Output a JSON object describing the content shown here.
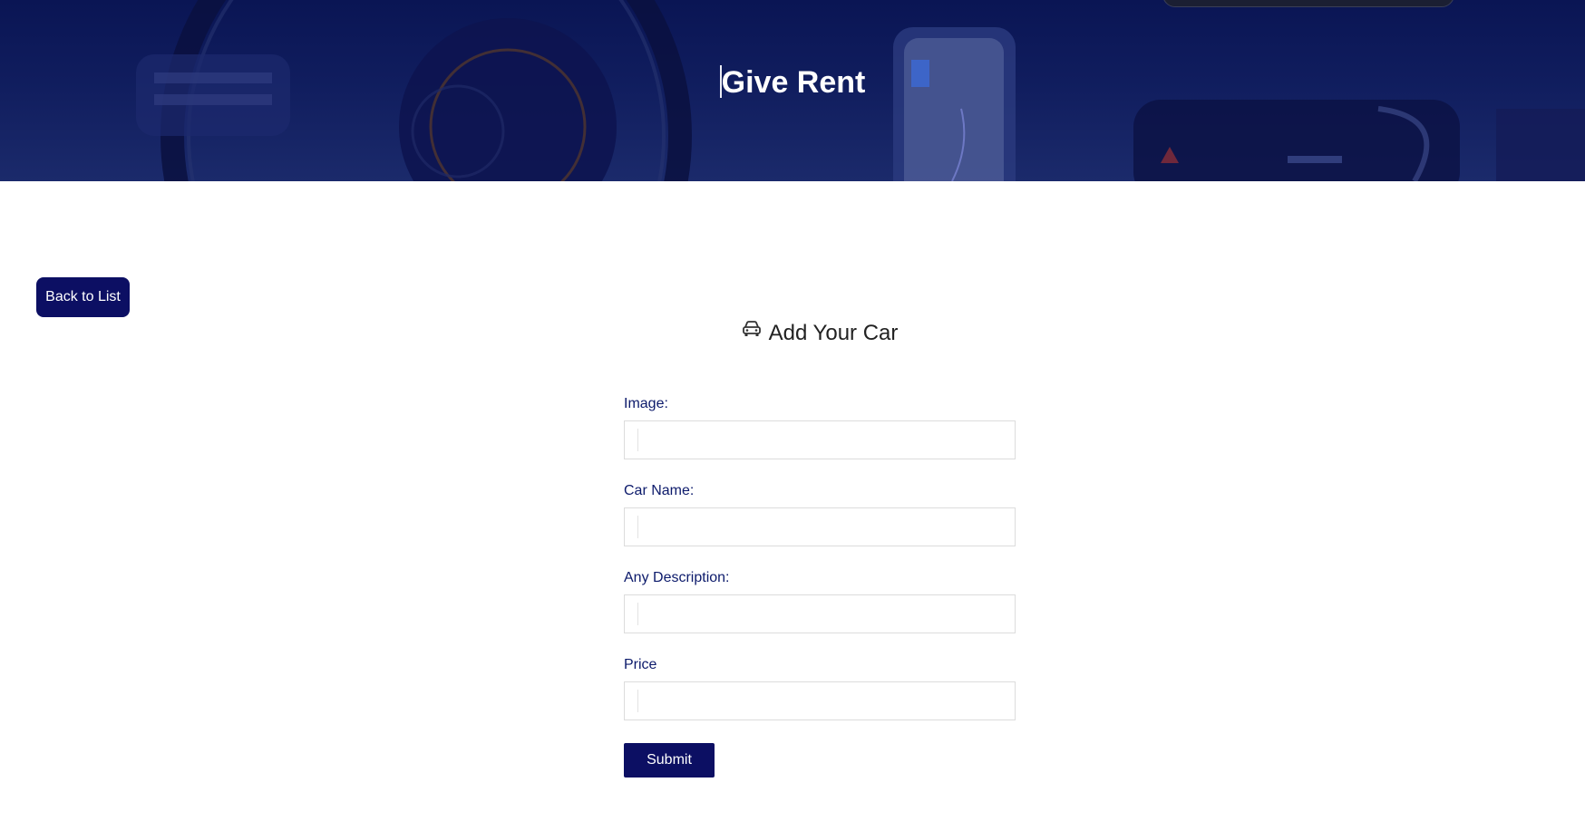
{
  "hero": {
    "title": "Give Rent",
    "background": "car-dashboard-image"
  },
  "nav": {
    "back_label": "Back to List"
  },
  "form": {
    "heading": "Add Your Car",
    "heading_icon": "car-icon",
    "fields": [
      {
        "label": "Image:",
        "value": "",
        "placeholder": ""
      },
      {
        "label": "Car Name:",
        "value": "",
        "placeholder": ""
      },
      {
        "label": "Any Description:",
        "value": "",
        "placeholder": ""
      },
      {
        "label": "Price",
        "value": "",
        "placeholder": ""
      }
    ],
    "submit_label": "Submit"
  },
  "colors": {
    "primary": "#0c0f63",
    "label": "#0c1a6b",
    "hero_overlay": "#0a1554"
  }
}
